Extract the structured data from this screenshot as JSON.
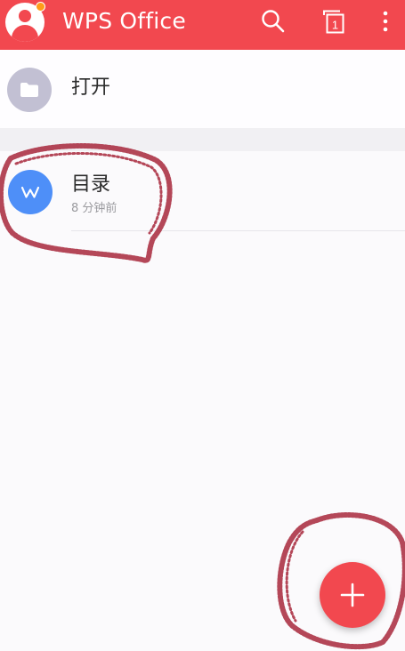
{
  "appbar": {
    "title": "WPS Office",
    "has_notification": true,
    "tab_count": "1",
    "icons": {
      "avatar": "user-avatar-icon",
      "search": "search-icon",
      "tabs": "tabs-icon",
      "more": "more-vert-icon"
    }
  },
  "open_row": {
    "label": "打开",
    "icon": "folder-icon"
  },
  "recent": [
    {
      "name": "目录",
      "time": "8 分钟前",
      "icon": "word-doc-icon",
      "icon_letter": "W"
    }
  ],
  "fab": {
    "icon": "plus-icon"
  },
  "colors": {
    "brand": "#f2484f",
    "doc_blue": "#4e8ff8",
    "folder_gray": "#c2c0d3",
    "scribble": "#a8283c"
  }
}
